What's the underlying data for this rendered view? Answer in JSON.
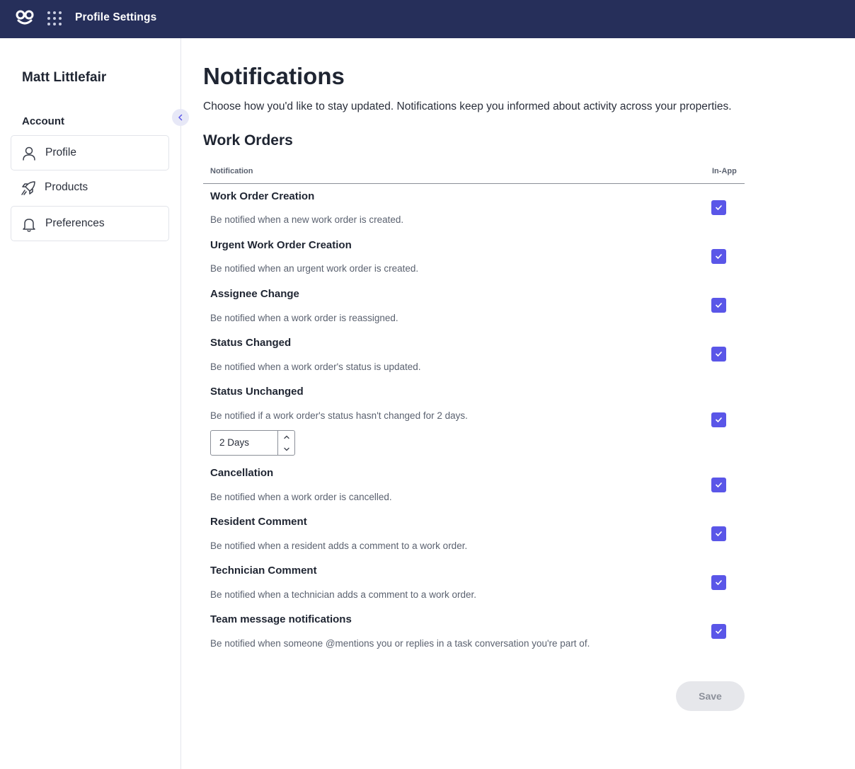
{
  "header": {
    "logo_text": "co",
    "title": "Profile Settings",
    "apps_icon": "grid-dots-icon"
  },
  "sidebar": {
    "user_name": "Matt Littlefair",
    "section_label": "Account",
    "items": [
      {
        "label": "Profile",
        "icon": "person-icon"
      },
      {
        "label": "Products",
        "icon": "rocket-icon"
      },
      {
        "label": "Preferences",
        "icon": "bell-icon"
      }
    ]
  },
  "main": {
    "title": "Notifications",
    "description": "Choose how you'd like to stay updated. Notifications keep you informed about activity across your properties.",
    "section_title": "Work Orders",
    "table": {
      "col_notification": "Notification",
      "col_inapp": "In-App",
      "rows": [
        {
          "title": "Work Order Creation",
          "description": "Be notified when a new work order is created.",
          "in_app": true
        },
        {
          "title": "Urgent Work Order Creation",
          "description": "Be notified when an urgent work order is created.",
          "in_app": true
        },
        {
          "title": "Assignee Change",
          "description": "Be notified when a work order is reassigned.",
          "in_app": true
        },
        {
          "title": "Status Changed",
          "description": "Be notified when a work order's status is updated.",
          "in_app": true
        },
        {
          "title": "Status Unchanged",
          "description": "Be notified if a work order's status hasn't changed for 2 days.",
          "in_app": true,
          "stepper_value": "2 Days"
        },
        {
          "title": "Cancellation",
          "description": "Be notified when a work order is cancelled.",
          "in_app": true
        },
        {
          "title": "Resident Comment",
          "description": "Be notified when a resident adds a comment to a work order.",
          "in_app": true
        },
        {
          "title": "Technician Comment",
          "description": "Be notified when a technician adds a comment to a work order.",
          "in_app": true
        },
        {
          "title": "Team message notifications",
          "description": "Be notified when someone @mentions you or replies in a task conversation you're part of.",
          "in_app": true
        }
      ]
    },
    "save_label": "Save"
  },
  "colors": {
    "topbar": "#262f5a",
    "checkbox": "#5a56e8",
    "save_disabled_bg": "#e6e7eb"
  }
}
